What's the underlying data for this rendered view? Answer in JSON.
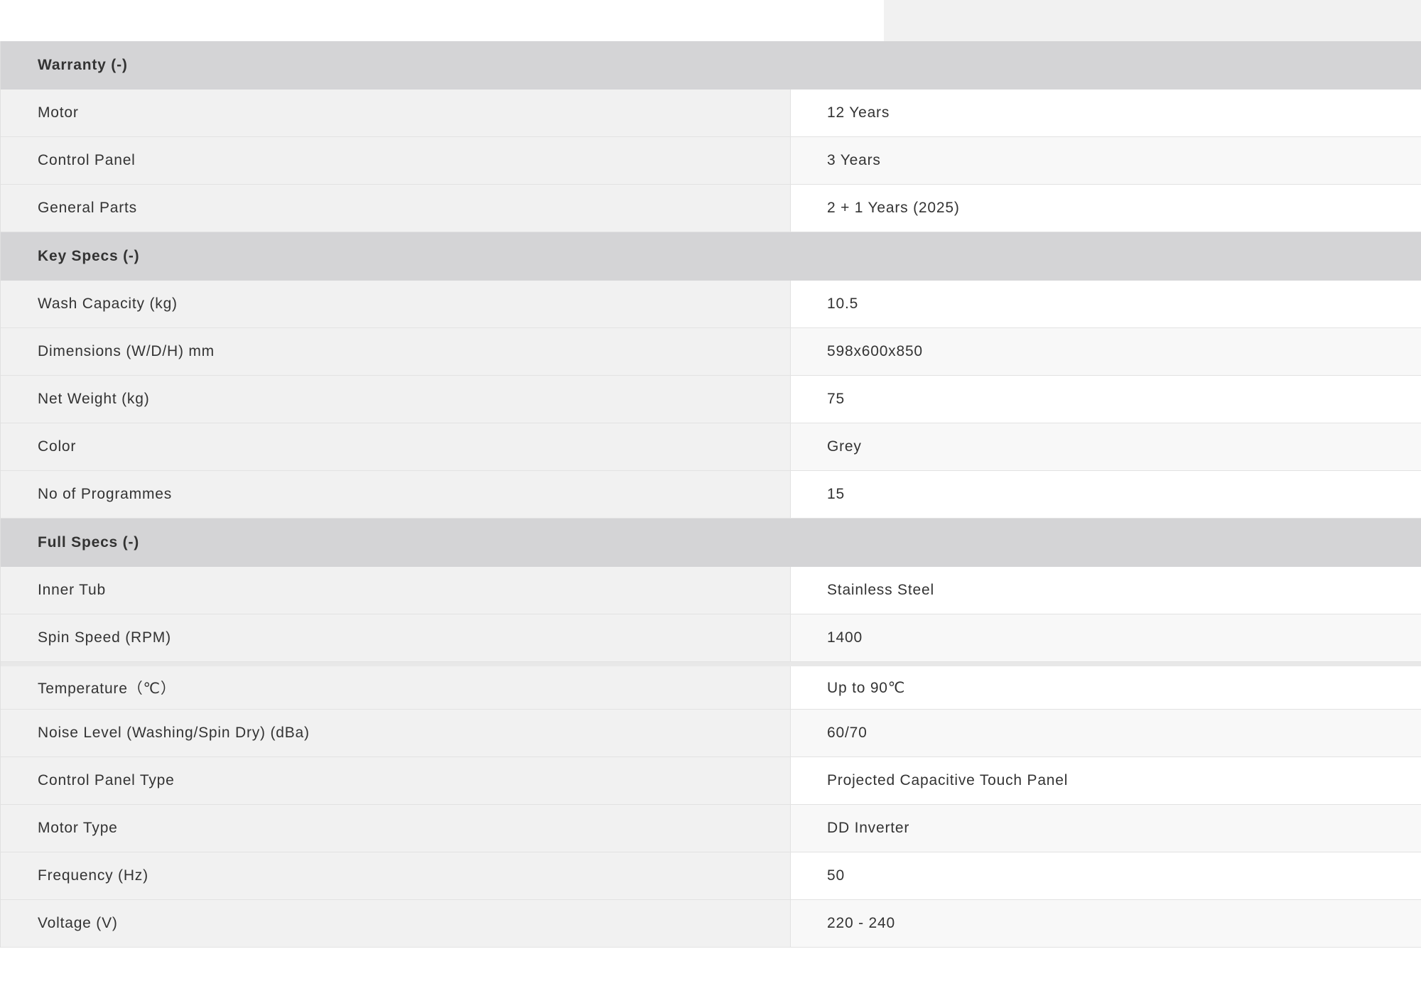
{
  "sections": [
    {
      "title": "Warranty (-)",
      "rows": [
        {
          "label": "Motor",
          "value": "12 Years"
        },
        {
          "label": "Control Panel",
          "value": "3 Years"
        },
        {
          "label": "General Parts",
          "value": "2 + 1 Years (2025)"
        }
      ]
    },
    {
      "title": "Key Specs (-)",
      "rows": [
        {
          "label": "Wash Capacity (kg)",
          "value": "10.5"
        },
        {
          "label": "Dimensions (W/D/H) mm",
          "value": "598x600x850"
        },
        {
          "label": "Net Weight (kg)",
          "value": "75"
        },
        {
          "label": "Color",
          "value": "Grey"
        },
        {
          "label": "No of Programmes",
          "value": "15"
        }
      ]
    },
    {
      "title": "Full Specs (-)",
      "rows": [
        {
          "label": "Inner Tub",
          "value": "Stainless Steel"
        },
        {
          "label": "Spin Speed (RPM)",
          "value": "1400"
        },
        {
          "label": "Temperature（℃）",
          "value": "Up to 90℃"
        },
        {
          "label": "Noise Level (Washing/Spin Dry) (dBa)",
          "value": "60/70"
        },
        {
          "label": "Control Panel Type",
          "value": "Projected Capacitive Touch Panel"
        },
        {
          "label": "Motor Type",
          "value": "DD Inverter"
        },
        {
          "label": "Frequency (Hz)",
          "value": "50"
        },
        {
          "label": "Voltage (V)",
          "value": "220 - 240"
        }
      ]
    }
  ],
  "colors": {
    "section_header_bg": "#d4d4d6",
    "label_bg": "#f1f1f1",
    "value_bg_odd": "#ffffff",
    "value_bg_even": "#f8f8f8"
  }
}
